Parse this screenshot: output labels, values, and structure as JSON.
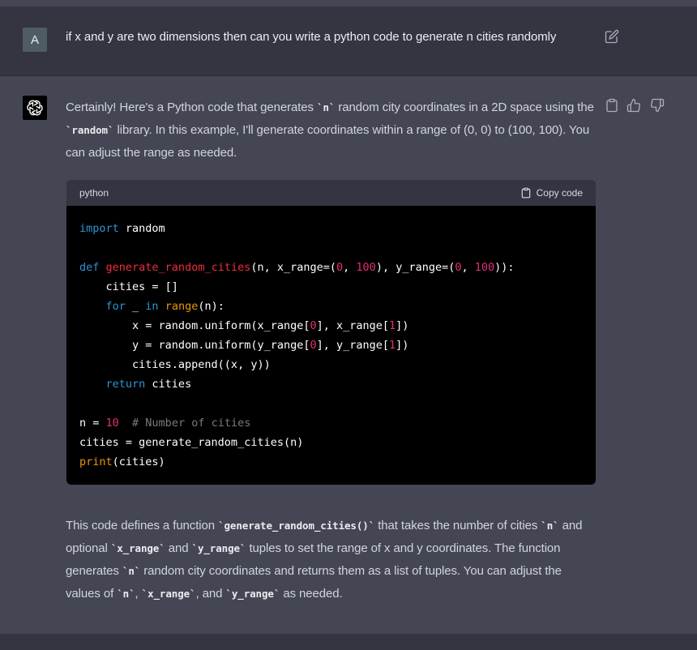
{
  "user_message": {
    "avatar_letter": "A",
    "text": "if x and y are two dimensions then can you write a python code to generate n cities randomly"
  },
  "assistant_message": {
    "intro": {
      "p1": "Certainly! Here's a Python code that generates ",
      "c1": "`n`",
      "p2": " random city coordinates in a 2D space using the ",
      "c2": "`random`",
      "p3": " library. In this example, I'll generate coordinates within a range of (0, 0) to (100, 100). You can adjust the range as needed."
    },
    "code_block": {
      "language": "python",
      "copy_label": "Copy code"
    },
    "outro": {
      "p1": "This code defines a function ",
      "c1": "`generate_random_cities()`",
      "p2": " that takes the number of cities ",
      "c2": "`n`",
      "p3": " and optional ",
      "c3": "`x_range`",
      "p4": " and ",
      "c4": "`y_range`",
      "p5": " tuples to set the range of x and y coordinates. The function generates ",
      "c5": "`n`",
      "p6": " random city coordinates and returns them as a list of tuples. You can adjust the values of ",
      "c6": "`n`",
      "p7": ", ",
      "c7": "`x_range`",
      "p8": ", and ",
      "c8": "`y_range`",
      "p9": " as needed."
    }
  },
  "icons": {
    "edit": "edit-icon",
    "copy": "clipboard-icon",
    "like": "thumbs-up-icon",
    "dislike": "thumbs-down-icon",
    "assistant_logo": "openai-logo-icon"
  }
}
